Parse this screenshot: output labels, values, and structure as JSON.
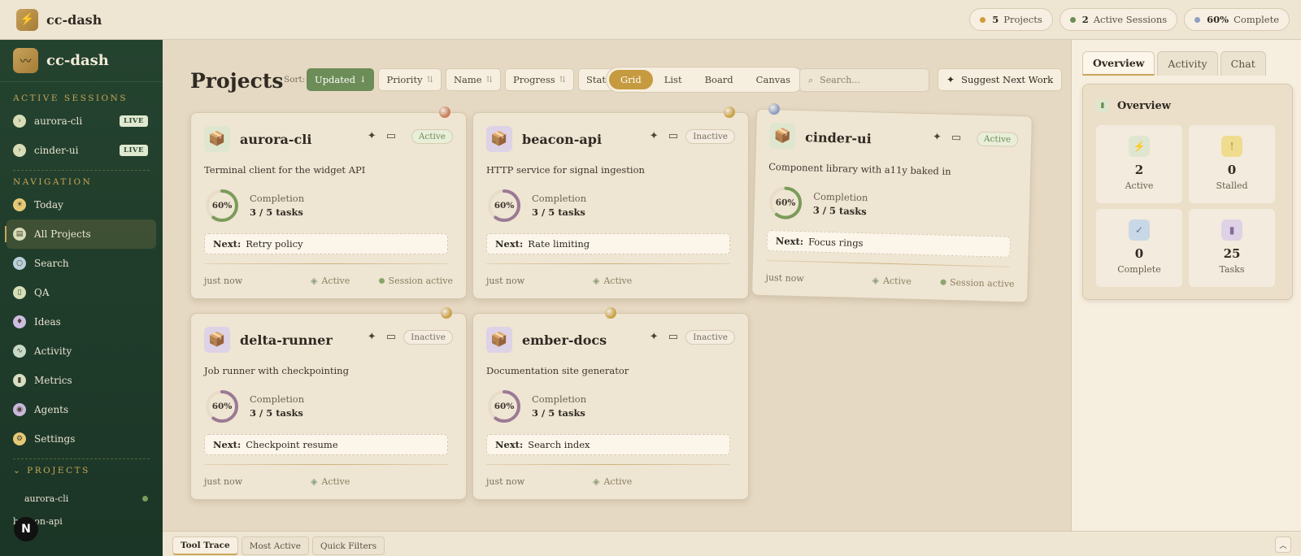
{
  "app": {
    "name": "cc-dash"
  },
  "top_stats": [
    {
      "value": "5",
      "label": "Projects",
      "color": "#d09a3c"
    },
    {
      "value": "2",
      "label": "Active Sessions",
      "color": "#6c8d57"
    },
    {
      "value": "60%",
      "label": "Complete",
      "color": "#8fa0c0"
    }
  ],
  "sidebar": {
    "brand": "cc-dash",
    "sessions_label": "ACTIVE SESSIONS",
    "sessions": [
      {
        "name": "aurora-cli",
        "badge": "LIVE"
      },
      {
        "name": "cinder-ui",
        "badge": "LIVE"
      }
    ],
    "nav_label": "NAVIGATION",
    "nav": [
      {
        "label": "Today",
        "icon": "sun-icon",
        "color": "#e6c977"
      },
      {
        "label": "All Projects",
        "icon": "folder-icon",
        "color": "#d7dcb7",
        "active": true
      },
      {
        "label": "Search",
        "icon": "search-icon",
        "color": "#b9cfd9"
      },
      {
        "label": "QA",
        "icon": "clipboard-icon",
        "color": "#d5e0b8"
      },
      {
        "label": "Ideas",
        "icon": "lightbulb-icon",
        "color": "#cdbde0"
      },
      {
        "label": "Activity",
        "icon": "pulse-icon",
        "color": "#c7d9c6"
      },
      {
        "label": "Metrics",
        "icon": "bar-chart-icon",
        "color": "#d6dfc4"
      },
      {
        "label": "Agents",
        "icon": "robot-icon",
        "color": "#c9b8dc"
      },
      {
        "label": "Settings",
        "icon": "gear-icon",
        "color": "#e6c977"
      }
    ],
    "projects_label": "PROJECTS",
    "projects": [
      "aurora-cli",
      "beacon-api"
    ]
  },
  "toolbar": {
    "title": "Projects",
    "sort_label": "Sort:",
    "sort": [
      {
        "label": "Updated",
        "arrow": "↓",
        "on": true
      },
      {
        "label": "Priority",
        "arrow": "⇅"
      },
      {
        "label": "Name",
        "arrow": "⇅"
      },
      {
        "label": "Progress",
        "arrow": "⇅"
      },
      {
        "label": "Status",
        "arrow": "⇅"
      }
    ],
    "views": [
      {
        "label": "Grid",
        "on": true
      },
      {
        "label": "List"
      },
      {
        "label": "Board"
      },
      {
        "label": "Canvas"
      }
    ],
    "search_placeholder": "Search...",
    "suggest_label": "Suggest Next Work"
  },
  "projects": [
    {
      "name": "aurora-cli",
      "status": "Active",
      "desc": "Terminal client for the widget API",
      "progress": 60,
      "pct_label": "60%",
      "completion_label": "Completion",
      "tasks": "3 / 5 tasks",
      "next_label": "Next:",
      "next": "Retry policy",
      "when": "just now",
      "footer_status": "Active",
      "session": "Session active",
      "pin": "#c9805a",
      "ring": "#7a9c5a",
      "icon_bg": "#dfe6cf"
    },
    {
      "name": "beacon-api",
      "status": "Inactive",
      "desc": "HTTP service for signal ingestion",
      "progress": 60,
      "pct_label": "60%",
      "completion_label": "Completion",
      "tasks": "3 / 5 tasks",
      "next_label": "Next:",
      "next": "Rate limiting",
      "when": "just now",
      "footer_status": "Active",
      "session": "",
      "pin": "#c9a24a",
      "ring": "#9a7a94",
      "icon_bg": "#ddd2e6"
    },
    {
      "name": "cinder-ui",
      "status": "Active",
      "desc": "Component library with a11y baked in",
      "progress": 60,
      "pct_label": "60%",
      "completion_label": "Completion",
      "tasks": "3 / 5 tasks",
      "next_label": "Next:",
      "next": "Focus rings",
      "when": "just now",
      "footer_status": "Active",
      "session": "Session active",
      "pin": "#8fa0c0",
      "ring": "#7a9c5a",
      "icon_bg": "#dfe6cf"
    },
    {
      "name": "delta-runner",
      "status": "Inactive",
      "desc": "Job runner with checkpointing",
      "progress": 60,
      "pct_label": "60%",
      "completion_label": "Completion",
      "tasks": "3 / 5 tasks",
      "next_label": "Next:",
      "next": "Checkpoint resume",
      "when": "just now",
      "footer_status": "Active",
      "session": "",
      "pin": "#c9a24a",
      "ring": "#9a7a94",
      "icon_bg": "#ddd2e6"
    },
    {
      "name": "ember-docs",
      "status": "Inactive",
      "desc": "Documentation site generator",
      "progress": 60,
      "pct_label": "60%",
      "completion_label": "Completion",
      "tasks": "3 / 5 tasks",
      "next_label": "Next:",
      "next": "Search index",
      "when": "just now",
      "footer_status": "Active",
      "session": "",
      "pin": "#c9a24a",
      "ring": "#9a7a94",
      "icon_bg": "#ddd2e6"
    }
  ],
  "right_panel": {
    "tabs": [
      {
        "label": "Overview",
        "on": true
      },
      {
        "label": "Activity"
      },
      {
        "label": "Chat"
      }
    ],
    "overview_title": "Overview",
    "tiles": [
      {
        "value": "2",
        "label": "Active",
        "icon": "bolt-icon",
        "color": "#dfe6cf"
      },
      {
        "value": "0",
        "label": "Stalled",
        "icon": "alert-icon",
        "color": "#f0dc8f"
      },
      {
        "value": "0",
        "label": "Complete",
        "icon": "check-icon",
        "color": "#c9d8e6"
      },
      {
        "value": "25",
        "label": "Tasks",
        "icon": "bar-chart-icon",
        "color": "#ddd2e6"
      }
    ]
  },
  "bottom_bar": {
    "tabs": [
      {
        "label": "Tool Trace",
        "on": true
      },
      {
        "label": "Most Active"
      },
      {
        "label": "Quick Filters"
      }
    ]
  }
}
